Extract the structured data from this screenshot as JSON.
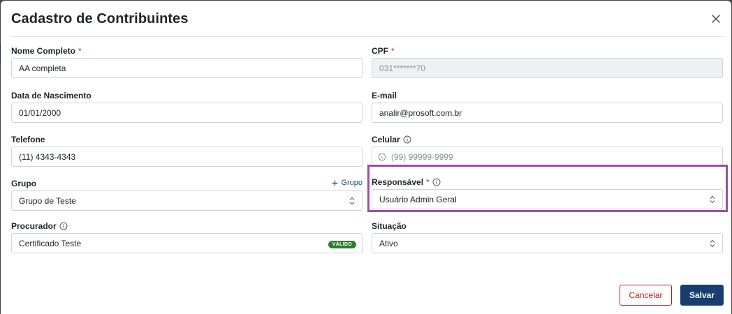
{
  "modal": {
    "title": "Cadastro de Contribuintes"
  },
  "fields": {
    "nome": {
      "label": "Nome Completo",
      "required": "*",
      "value": "AA completa"
    },
    "cpf": {
      "label": "CPF",
      "required": "*",
      "value": "031*******70"
    },
    "nascimento": {
      "label": "Data de Nascimento",
      "value": "01/01/2000"
    },
    "email": {
      "label": "E-mail",
      "value": "analir@prosoft.com.br"
    },
    "telefone": {
      "label": "Telefone",
      "value": "(11) 4343-4343"
    },
    "celular": {
      "label": "Celular",
      "placeholder": "(99) 99999-9999"
    },
    "grupo": {
      "label": "Grupo",
      "value": "Grupo de Teste",
      "add_label": "Grupo"
    },
    "responsavel": {
      "label": "Responsável",
      "required": "*",
      "value": "Usuário Admin Geral"
    },
    "procurador": {
      "label": "Procurador",
      "value": "Certificado Teste",
      "badge": "VÁLIDO"
    },
    "situacao": {
      "label": "Situação",
      "value": "Ativo"
    }
  },
  "actions": {
    "cancel_label": "Cancelar",
    "save_label": "Salvar"
  },
  "colors": {
    "primary": "#173e6e",
    "danger": "#b71c1c",
    "success": "#2e7d32",
    "highlight": "#9c4fa5",
    "required": "#c62828"
  },
  "icons": {
    "close": "close-icon",
    "info": "info-icon",
    "whatsapp": "whatsapp-icon",
    "select": "select-arrows-icon",
    "plus": "plus-icon"
  }
}
